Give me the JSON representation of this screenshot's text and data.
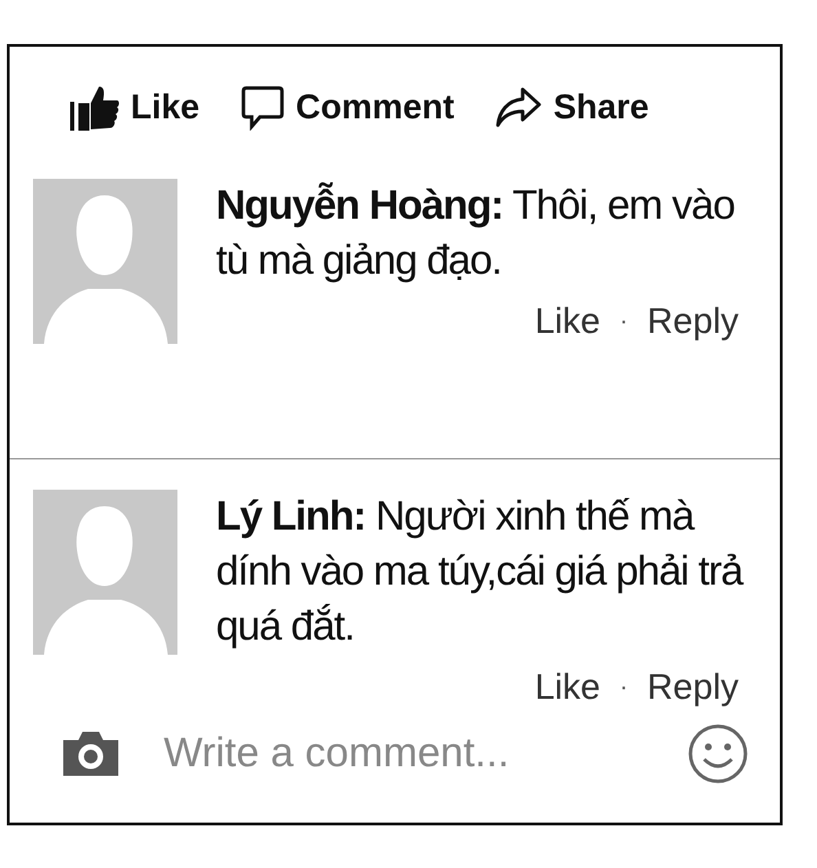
{
  "actions": [
    {
      "kind": "like",
      "label": "Like"
    },
    {
      "kind": "comment",
      "label": "Comment"
    },
    {
      "kind": "share",
      "label": "Share"
    }
  ],
  "comments": [
    {
      "author": "Nguyễn Hoàng:",
      "text": "Thôi, em vào tù mà giảng đạo.",
      "like": "Like",
      "separator": "·",
      "reply": "Reply"
    },
    {
      "author": "Lý Linh:",
      "text": "Người xinh thế mà dính vào ma túy,cái giá phải trả quá đắt.",
      "like": "Like",
      "separator": "·",
      "reply": "Reply"
    }
  ],
  "composer": {
    "placeholder": "Write a comment..."
  }
}
